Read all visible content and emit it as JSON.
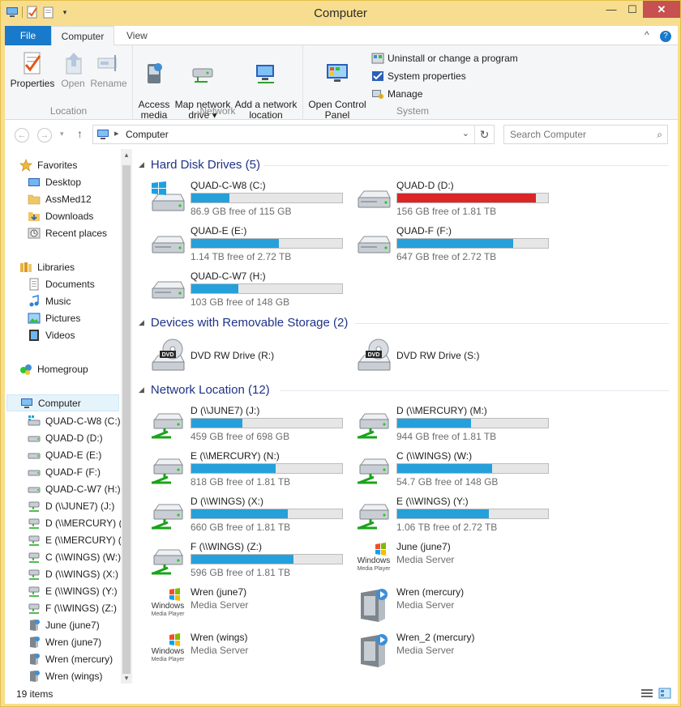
{
  "window": {
    "title": "Computer",
    "close_glyph": "✕",
    "min_glyph": "—",
    "max_glyph": "☐"
  },
  "tabs": {
    "file": "File",
    "computer": "Computer",
    "view": "View",
    "minimize_ribbon": "^",
    "help": "?"
  },
  "ribbon": {
    "location": {
      "label": "Location",
      "properties": "Properties",
      "open": "Open",
      "rename": "Rename"
    },
    "network": {
      "label": "Network",
      "access_media": "Access\nmedia ▾",
      "map_network_drive": "Map network\ndrive ▾",
      "add_network_location": "Add a network\nlocation"
    },
    "system": {
      "label": "System",
      "open_control_panel": "Open Control\nPanel",
      "uninstall": "Uninstall or change a program",
      "system_properties": "System properties",
      "manage": "Manage"
    }
  },
  "address": {
    "crumb": "Computer",
    "search_placeholder": "Search Computer"
  },
  "nav": {
    "favorites": "Favorites",
    "favorites_items": [
      "Desktop",
      "AssMed12",
      "Downloads",
      "Recent places"
    ],
    "libraries": "Libraries",
    "libraries_items": [
      "Documents",
      "Music",
      "Pictures",
      "Videos"
    ],
    "homegroup": "Homegroup",
    "computer": "Computer",
    "computer_items": [
      "QUAD-C-W8 (C:)",
      "QUAD-D (D:)",
      "QUAD-E (E:)",
      "QUAD-F (F:)",
      "QUAD-C-W7 (H:)",
      "D (\\\\JUNE7) (J:)",
      "D (\\\\MERCURY) (",
      "E (\\\\MERCURY) (",
      "C (\\\\WINGS) (W:)",
      "D (\\\\WINGS) (X:)",
      "E (\\\\WINGS) (Y:)",
      "F (\\\\WINGS) (Z:)",
      "June (june7)",
      "Wren (june7)",
      "Wren (mercury)",
      "Wren (wings)"
    ]
  },
  "groups": {
    "hdd": "Hard Disk Drives (5)",
    "removable": "Devices with Removable Storage (2)",
    "network": "Network Location (12)"
  },
  "hdd": [
    {
      "name": "QUAD-C-W8 (C:)",
      "info": "86.9 GB free of 115 GB",
      "used": 0.25,
      "icon": "windows-drive-icon"
    },
    {
      "name": "QUAD-D (D:)",
      "info": "156 GB free of 1.81 TB",
      "used": 0.92,
      "icon": "hard-drive-icon"
    },
    {
      "name": "QUAD-E (E:)",
      "info": "1.14 TB free of 2.72 TB",
      "used": 0.58,
      "icon": "hard-drive-icon"
    },
    {
      "name": "QUAD-F (F:)",
      "info": "647 GB free of 2.72 TB",
      "used": 0.77,
      "icon": "hard-drive-icon"
    },
    {
      "name": "QUAD-C-W7 (H:)",
      "info": "103 GB free of 148 GB",
      "used": 0.31,
      "icon": "hard-drive-icon"
    }
  ],
  "removable": [
    {
      "name": "DVD RW Drive (R:)",
      "icon": "dvd-drive-icon"
    },
    {
      "name": "DVD RW Drive (S:)",
      "icon": "dvd-drive-icon"
    }
  ],
  "network": [
    {
      "name": "D (\\\\JUNE7) (J:)",
      "info": "459 GB free of 698 GB",
      "used": 0.34
    },
    {
      "name": "D (\\\\MERCURY) (M:)",
      "info": "944 GB free of 1.81 TB",
      "used": 0.49
    },
    {
      "name": "E (\\\\MERCURY) (N:)",
      "info": "818 GB free of 1.81 TB",
      "used": 0.56
    },
    {
      "name": "C (\\\\WINGS) (W:)",
      "info": "54.7 GB free of 148 GB",
      "used": 0.63
    },
    {
      "name": "D (\\\\WINGS) (X:)",
      "info": "660 GB free of 1.81 TB",
      "used": 0.64
    },
    {
      "name": "E (\\\\WINGS) (Y:)",
      "info": "1.06 TB free of 2.72 TB",
      "used": 0.61
    },
    {
      "name": "F (\\\\WINGS) (Z:)",
      "info": "596 GB free of 1.81 TB",
      "used": 0.68
    }
  ],
  "media": [
    {
      "name": "June (june7)",
      "sub": "Media Server",
      "icon": "windows-media-player-icon"
    },
    {
      "name": "Wren (june7)",
      "sub": "Media Server",
      "icon": "windows-media-player-icon"
    },
    {
      "name": "Wren (mercury)",
      "sub": "Media Server",
      "icon": "media-server-device-icon"
    },
    {
      "name": "Wren (wings)",
      "sub": "Media Server",
      "icon": "windows-media-player-icon"
    },
    {
      "name": "Wren_2 (mercury)",
      "sub": "Media Server",
      "icon": "media-server-device-icon"
    }
  ],
  "wmp_logo": {
    "line1": "Windows",
    "line2": "Media Player"
  },
  "status": {
    "items": "19 items"
  },
  "colors": {
    "accent": "#26a0da",
    "warning": "#da2626",
    "title_bg": "#f7dd8f",
    "file_tab": "#1979ca",
    "group_heading": "#1e3287"
  }
}
